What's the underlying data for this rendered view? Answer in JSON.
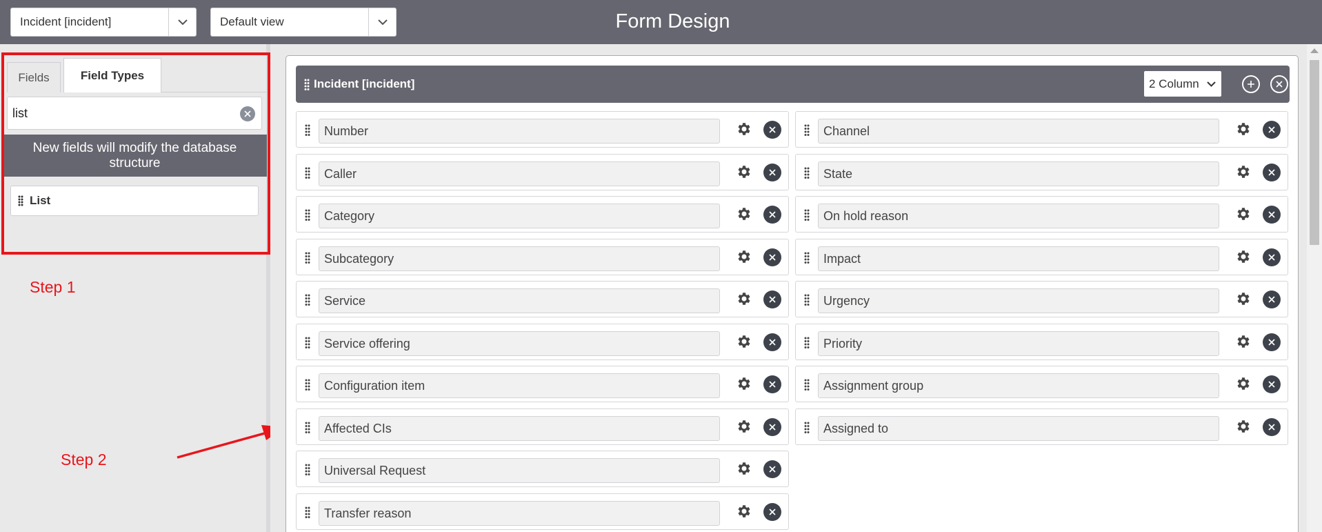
{
  "header": {
    "table_select": "Incident [incident]",
    "view_select": "Default view",
    "title": "Form Design"
  },
  "left": {
    "tabs": [
      {
        "label": "Fields",
        "active": false
      },
      {
        "label": "Field Types",
        "active": true
      }
    ],
    "filter_value": "list",
    "warning": "New fields will modify the database structure",
    "field_types": [
      "List"
    ]
  },
  "annotations": {
    "step1": "Step 1",
    "step2": "Step 2",
    "color": "#e8161b"
  },
  "form": {
    "section_title": "Incident [incident]",
    "column_layout": "2 Column",
    "left_fields": [
      "Number",
      "Caller",
      "Category",
      "Subcategory",
      "Service",
      "Service offering",
      "Configuration item",
      "Affected CIs",
      "Universal Request",
      "Transfer reason"
    ],
    "right_fields": [
      "Channel",
      "State",
      "On hold reason",
      "Impact",
      "Urgency",
      "Priority",
      "Assignment group",
      "Assigned to"
    ]
  },
  "colors": {
    "header_bg": "#666670",
    "panel_bg": "#e9e9ea",
    "icon_dark": "#3e424b"
  }
}
